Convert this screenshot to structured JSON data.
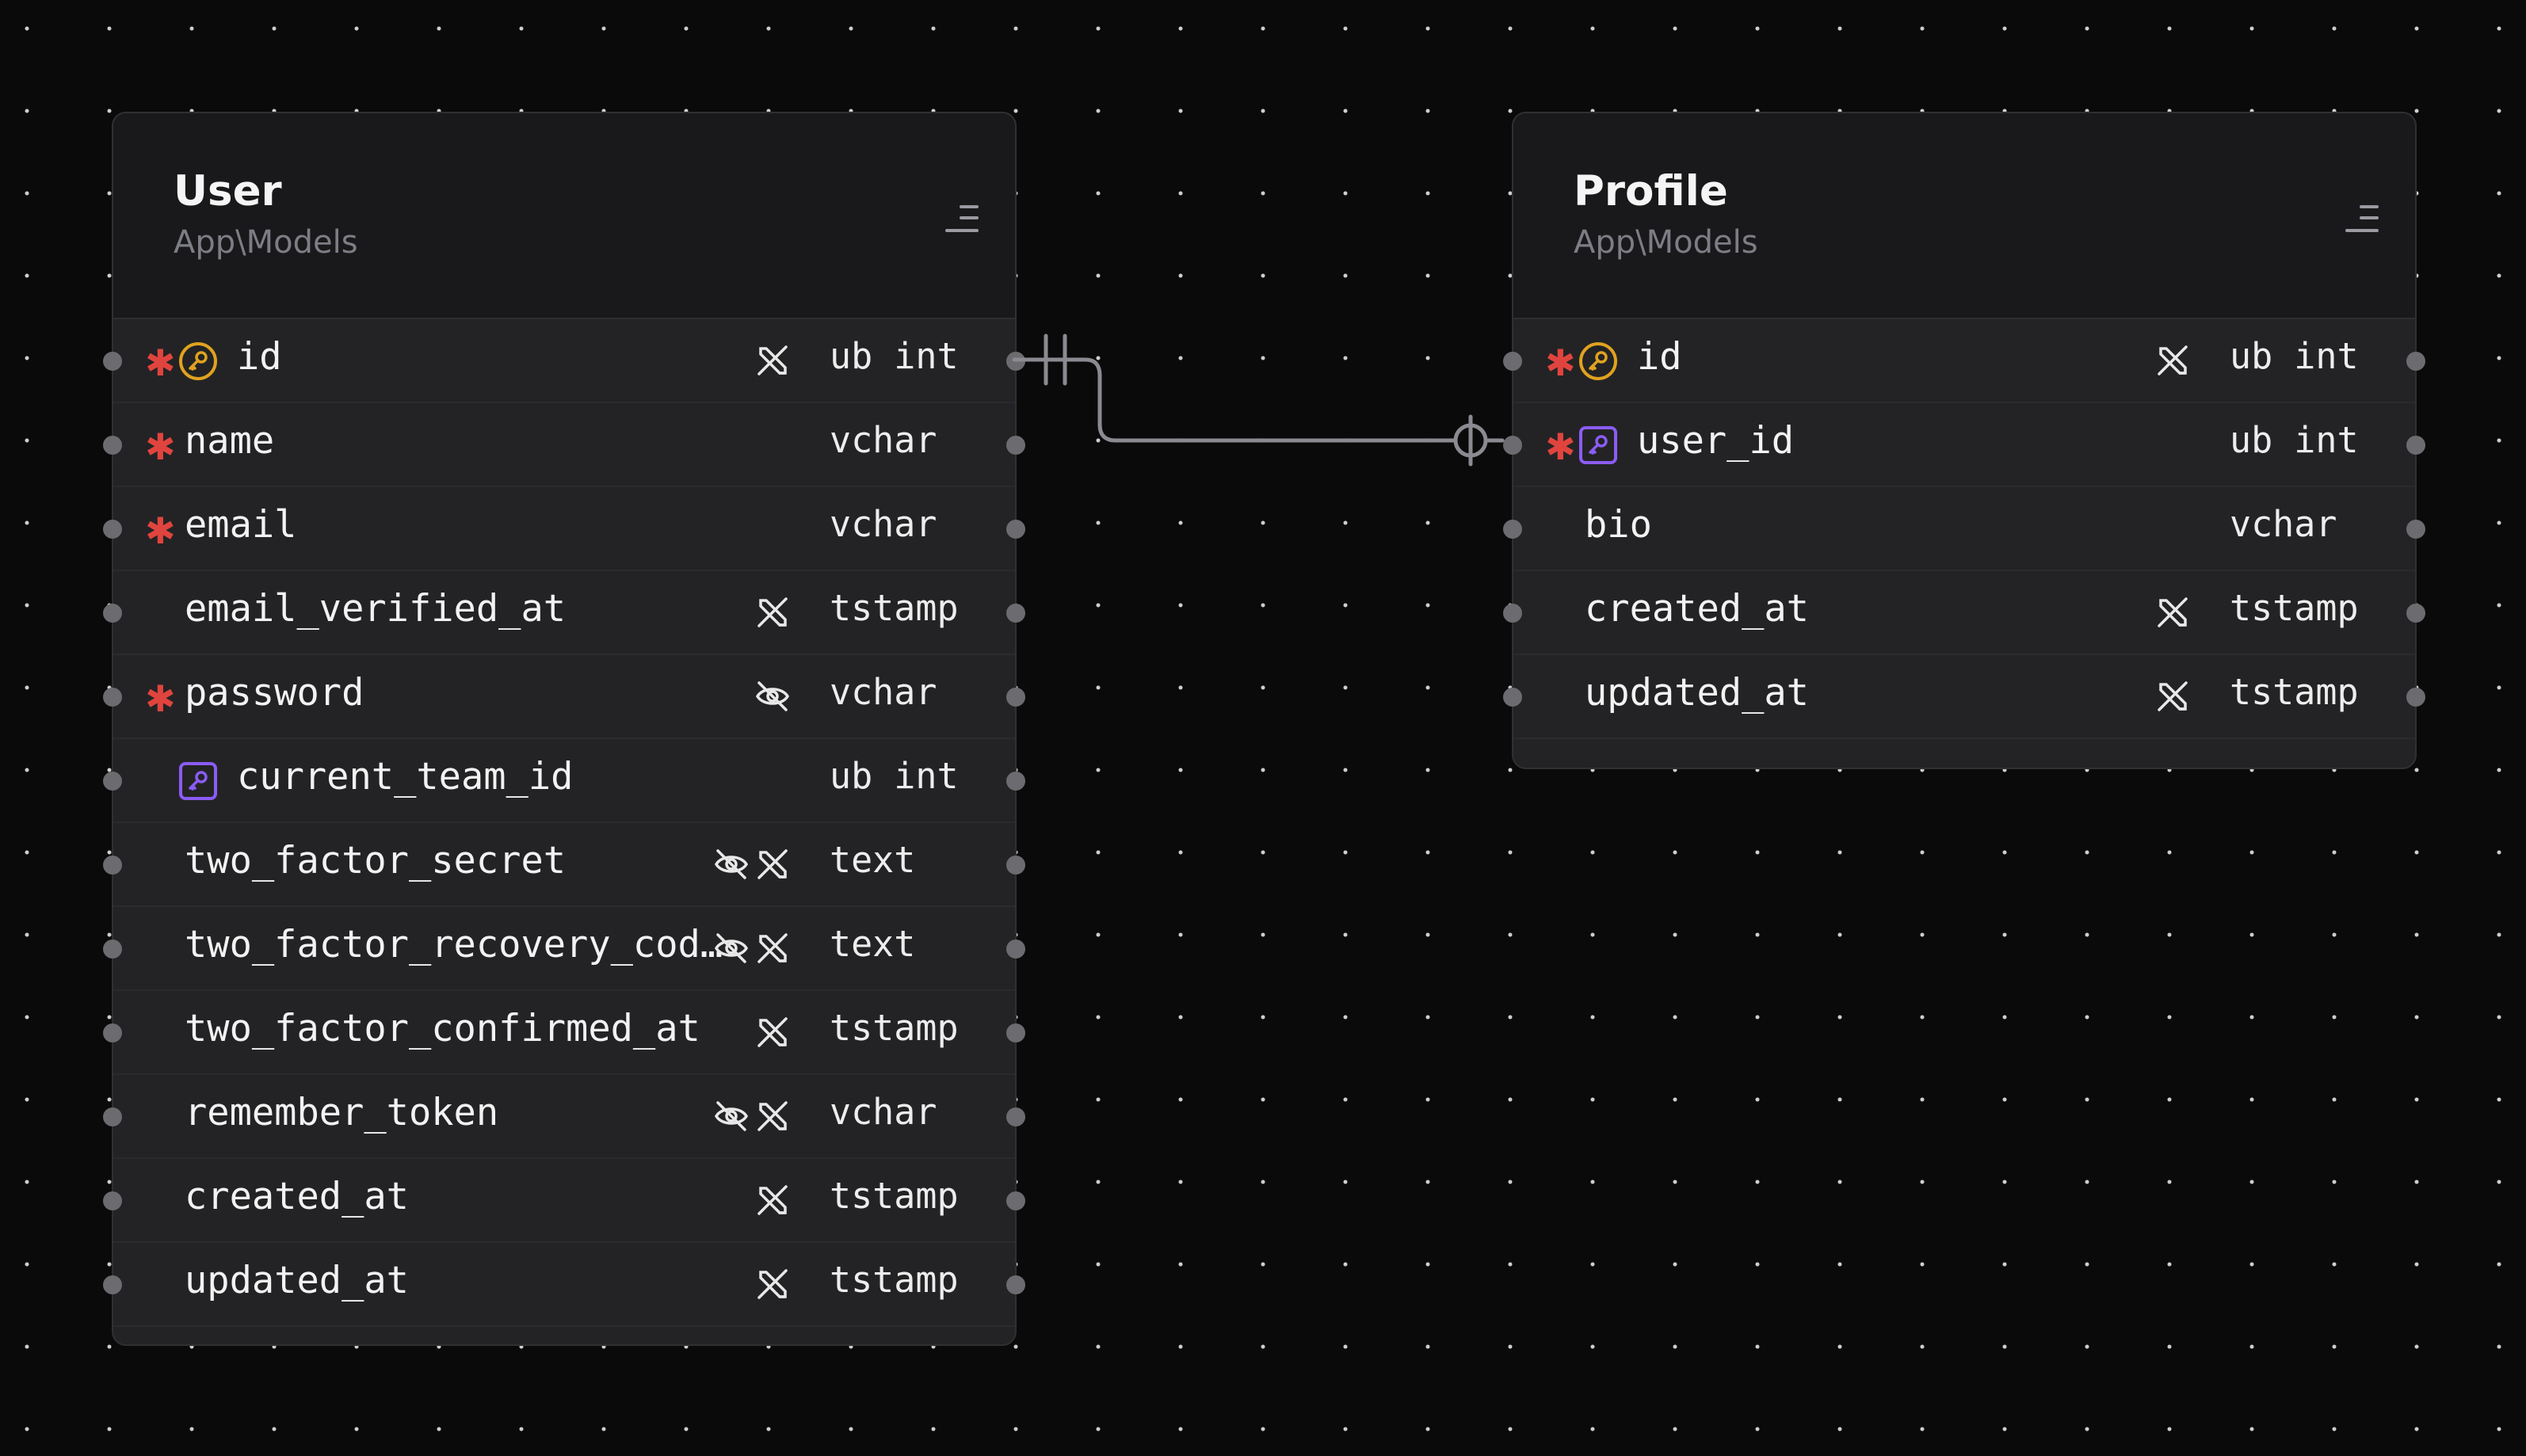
{
  "canvas": {
    "background": "#0a0a0a",
    "dot_color": "#cfcfcf"
  },
  "colors": {
    "required": "#e0443e",
    "primary_key": "#e0a21f",
    "foreign_key": "#8b5cf6",
    "handle": "#6b6b70"
  },
  "relation": {
    "from": "User.id",
    "to": "Profile.user_id",
    "from_cardinality": "exactly-one",
    "to_cardinality": "zero-or-one"
  },
  "tables": [
    {
      "name": "User",
      "namespace": "App\\Models",
      "menu_icon": "menu-icon",
      "columns": [
        {
          "name": "id",
          "type": "ub int",
          "required": true,
          "key": "primary",
          "flags": [
            "nullable-off-icon"
          ]
        },
        {
          "name": "name",
          "type": "vchar",
          "required": true,
          "key": null,
          "flags": []
        },
        {
          "name": "email",
          "type": "vchar",
          "required": true,
          "key": null,
          "flags": []
        },
        {
          "name": "email_verified_at",
          "type": "tstamp",
          "required": false,
          "key": null,
          "flags": [
            "nullable-off-icon"
          ]
        },
        {
          "name": "password",
          "type": "vchar",
          "required": true,
          "key": null,
          "flags": [
            "hidden-icon"
          ]
        },
        {
          "name": "current_team_id",
          "type": "ub int",
          "required": false,
          "key": "foreign",
          "flags": []
        },
        {
          "name": "two_factor_secret",
          "type": "text",
          "required": false,
          "key": null,
          "flags": [
            "hidden-icon",
            "nullable-off-icon"
          ]
        },
        {
          "name": "two_factor_recovery_cod…",
          "type": "text",
          "required": false,
          "key": null,
          "flags": [
            "hidden-icon",
            "nullable-off-icon"
          ]
        },
        {
          "name": "two_factor_confirmed_at",
          "type": "tstamp",
          "required": false,
          "key": null,
          "flags": [
            "nullable-off-icon"
          ]
        },
        {
          "name": "remember_token",
          "type": "vchar",
          "required": false,
          "key": null,
          "flags": [
            "hidden-icon",
            "nullable-off-icon"
          ]
        },
        {
          "name": "created_at",
          "type": "tstamp",
          "required": false,
          "key": null,
          "flags": [
            "nullable-off-icon"
          ]
        },
        {
          "name": "updated_at",
          "type": "tstamp",
          "required": false,
          "key": null,
          "flags": [
            "nullable-off-icon"
          ]
        }
      ]
    },
    {
      "name": "Profile",
      "namespace": "App\\Models",
      "menu_icon": "menu-icon",
      "columns": [
        {
          "name": "id",
          "type": "ub int",
          "required": true,
          "key": "primary",
          "flags": [
            "nullable-off-icon"
          ]
        },
        {
          "name": "user_id",
          "type": "ub int",
          "required": true,
          "key": "foreign",
          "flags": []
        },
        {
          "name": "bio",
          "type": "vchar",
          "required": false,
          "key": null,
          "flags": []
        },
        {
          "name": "created_at",
          "type": "tstamp",
          "required": false,
          "key": null,
          "flags": [
            "nullable-off-icon"
          ]
        },
        {
          "name": "updated_at",
          "type": "tstamp",
          "required": false,
          "key": null,
          "flags": [
            "nullable-off-icon"
          ]
        }
      ]
    }
  ]
}
